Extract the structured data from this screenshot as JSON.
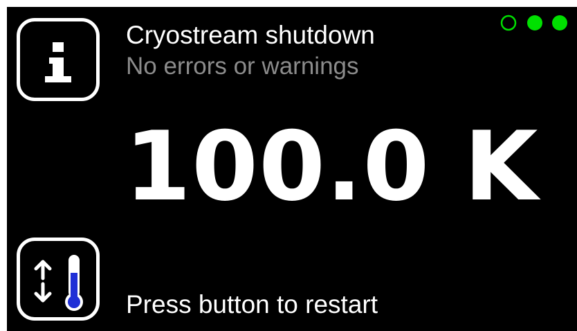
{
  "colors": {
    "background": "#000000",
    "text": "#ffffff",
    "muted_text": "#8c8c8c",
    "status_green": "#00e000",
    "thermometer_fill": "#1f2fd6"
  },
  "header": {
    "title": "Cryostream shutdown",
    "subtitle": "No errors or warnings"
  },
  "readout": {
    "value": "100.0",
    "unit": "K"
  },
  "footer": {
    "hint": "Press button to restart"
  },
  "status_indicators": [
    {
      "name": "status-dot-1",
      "filled": false
    },
    {
      "name": "status-dot-2",
      "filled": true
    },
    {
      "name": "status-dot-3",
      "filled": true
    }
  ],
  "icons": {
    "info": "info-icon",
    "temperature_adjust": "thermometer-arrows-icon"
  }
}
